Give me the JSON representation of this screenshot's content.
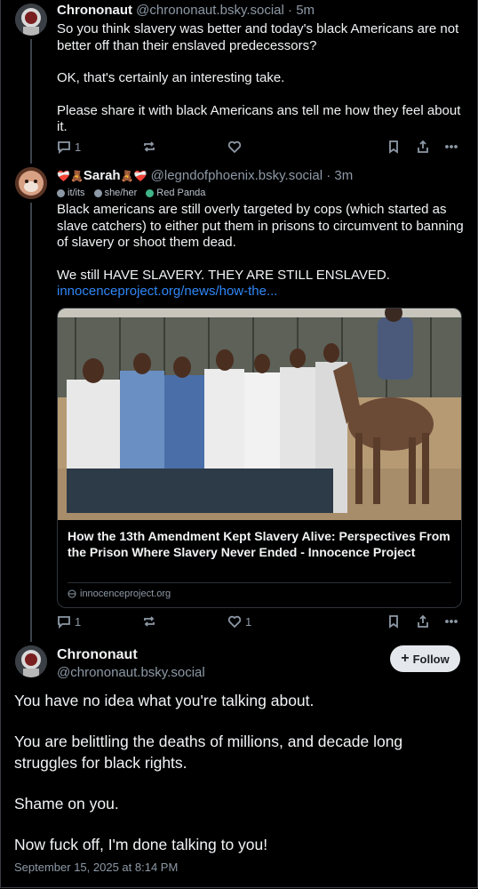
{
  "post1": {
    "name": "Chrononaut",
    "handle": "@chrononaut.bsky.social",
    "time": "· 5m",
    "paragraphs": [
      "So you think slavery was better and today's black Americans are not better off than their enslaved predecessors?",
      "OK, that's certainly an interesting take.",
      "Please share it with black Americans ans tell me how they feel about it."
    ],
    "actions": {
      "reply_count": "1",
      "repost_count": "",
      "like_count": ""
    }
  },
  "post2": {
    "name_prefix": "❤️‍🩹🧸",
    "name": "Sarah",
    "name_suffix": "🧸❤️‍🩹",
    "handle": "@legndofphoenix.bsky.social",
    "time": "· 3m",
    "badges": [
      "it/its",
      "she/her",
      "Red Panda"
    ],
    "paragraphs": [
      "Black americans are still overly targeted by cops (which started as slave catchers) to either put them in prisons to circumvent to banning of slavery or shoot them dead.",
      "We still HAVE SLAVERY. THEY ARE STILL ENSLAVED."
    ],
    "link_text": "innocenceproject.org/news/how-the...",
    "card": {
      "title": "How the 13th Amendment Kept Slavery Alive: Perspectives From the Prison Where Slavery Never Ended - Innocence Project",
      "source": "innocenceproject.org"
    },
    "actions": {
      "reply_count": "1",
      "repost_count": "",
      "like_count": "1"
    }
  },
  "main": {
    "name": "Chrononaut",
    "handle": "@chrononaut.bsky.social",
    "follow_label": "Follow",
    "paragraphs": [
      "You have no idea what you're talking about.",
      "You are belittling the deaths of millions, and decade long struggles for black rights.",
      "Shame on you.",
      "Now fuck off, I'm done talking to you!"
    ],
    "timestamp": "September 15, 2025 at 8:14 PM"
  },
  "colors": {
    "background": "#000000",
    "text": "#f1f3f5",
    "muted": "#8d99a6",
    "link": "#2f86f6",
    "follow_bg": "#e4e8ec"
  }
}
